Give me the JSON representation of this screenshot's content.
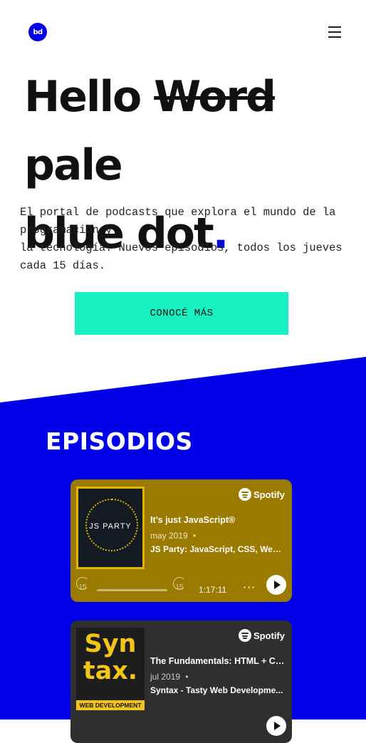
{
  "header": {
    "logo_text": "bd",
    "menu_icon": "hamburger-menu-icon"
  },
  "hero": {
    "word_hello": "Hello",
    "word_struck": "Word",
    "word_pale": "pale",
    "line2": "blue dot",
    "dot": "."
  },
  "intro": {
    "text": "El portal de podcasts que explora el mundo de la\nprogramación y\nla tecnología. Nuevos episodios, todos los jueves\ncada 15 días."
  },
  "cta": {
    "label": "CONOCÉ MÁS"
  },
  "episodes": {
    "title": "EPISODIOS",
    "items": [
      {
        "platform": "Spotify",
        "cover_text": "JS PARTY",
        "title": "It’s just JavaScript®",
        "date": "may 2019",
        "separator": "•",
        "show": "JS Party: JavaScript, CSS, Web...",
        "skip_back": "15",
        "skip_forward": "15",
        "duration": "1:17:11",
        "more": "···"
      },
      {
        "platform": "Spotify",
        "cover_text": "Syn\ntax.",
        "cover_band": "WEB DEVELOPMENT",
        "title": "The Fundamentals: HTML + CSS",
        "date": "jul 2019",
        "separator": "•",
        "show": "Syntax - Tasty Web Developme..."
      }
    ]
  },
  "colors": {
    "brand_blue": "#0000e8",
    "cta_green": "#19f0c1",
    "card1_bg": "#9b7a00",
    "card2_bg": "#2f2f2f"
  }
}
